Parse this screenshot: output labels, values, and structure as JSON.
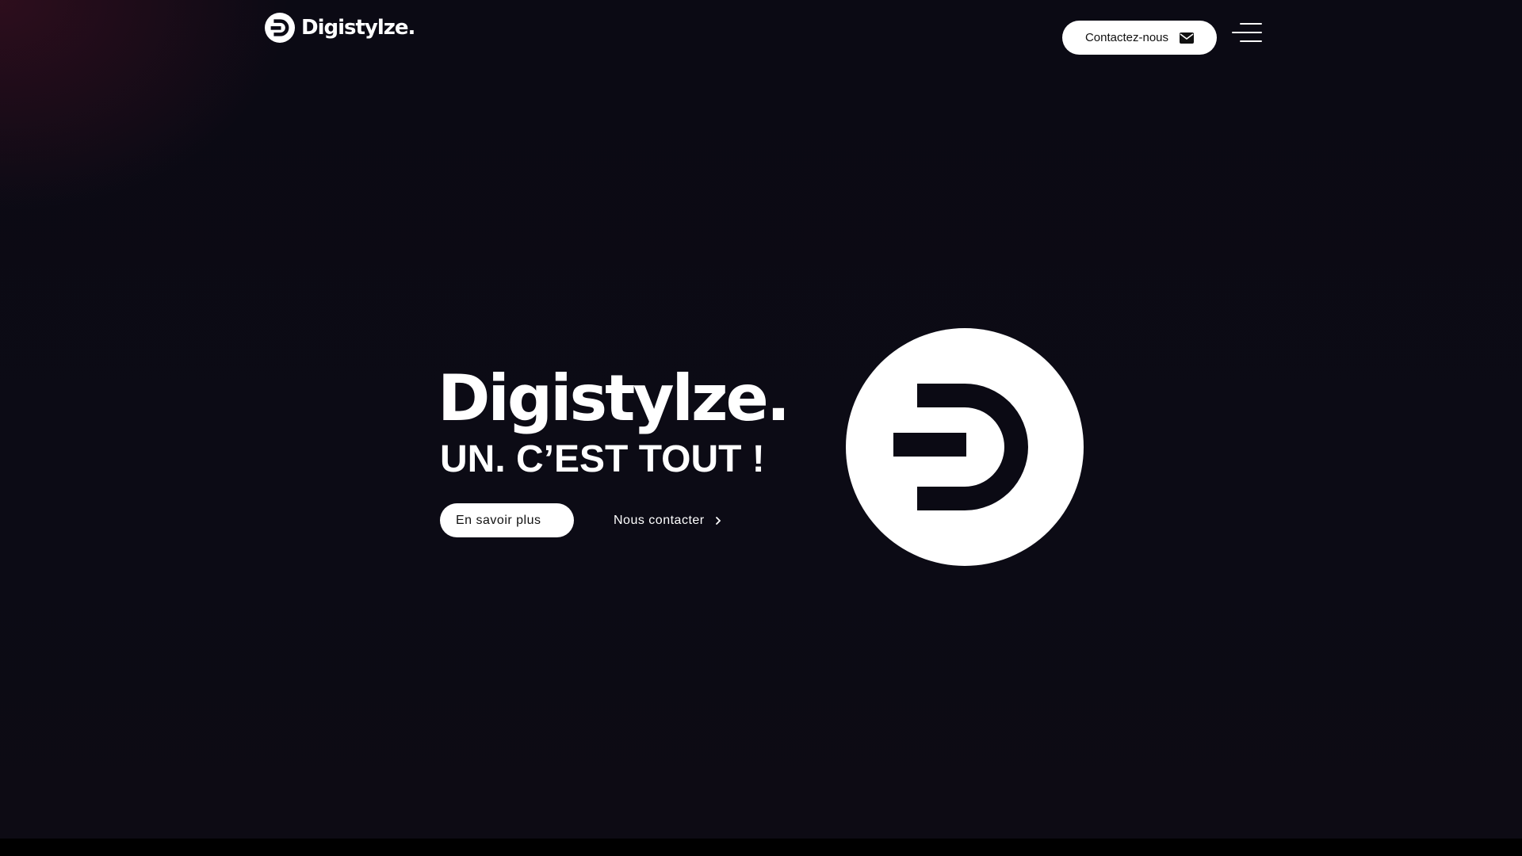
{
  "header": {
    "brand": "Digistylze.",
    "contact_button": "Contactez-nous",
    "contact_icon": "envelope-icon",
    "menu_icon": "hamburger-menu-icon"
  },
  "hero": {
    "title": "Digistylze.",
    "subtitle": "UN. C’EST TOUT !",
    "primary_button": "En savoir plus",
    "secondary_button": "Nous contacter",
    "secondary_icon": "chevron-right-icon"
  },
  "colors": {
    "background": "#0b0a14",
    "foreground": "#ffffff",
    "accent_glow": "#6e142d"
  }
}
